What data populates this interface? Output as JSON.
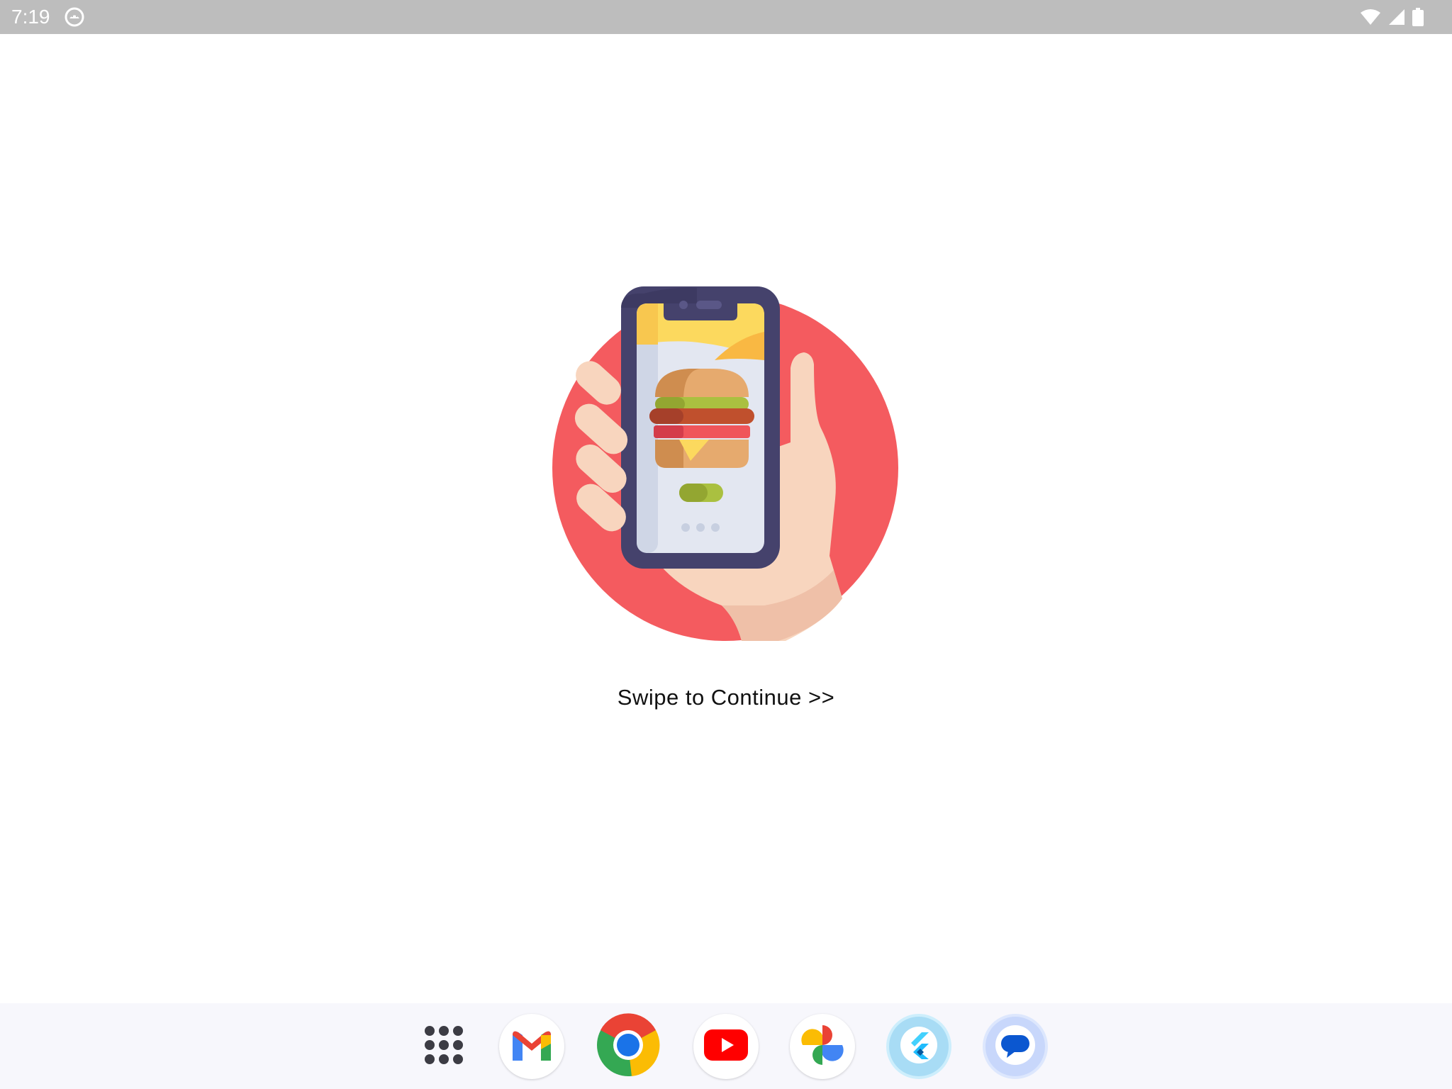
{
  "status_bar": {
    "time": "7:19",
    "icons": [
      "android-notification-icon",
      "wifi-icon",
      "cellular-signal-icon",
      "battery-icon"
    ]
  },
  "main": {
    "illustration": "hand-holding-phone-burger-illustration",
    "cta_text": "Swipe to Continue >>"
  },
  "dock": {
    "apps": [
      {
        "name": "app-drawer",
        "icon": "grid-dots-icon"
      },
      {
        "name": "gmail",
        "icon": "gmail-icon"
      },
      {
        "name": "chrome",
        "icon": "chrome-icon"
      },
      {
        "name": "youtube",
        "icon": "youtube-icon"
      },
      {
        "name": "photos",
        "icon": "google-photos-icon"
      },
      {
        "name": "flutter",
        "icon": "flutter-icon"
      },
      {
        "name": "messages",
        "icon": "messages-icon"
      }
    ]
  },
  "colors": {
    "status_bar": "#bdbdbd",
    "accent_circle": "#f45b5f",
    "dock_background": "#f7f7fc"
  }
}
